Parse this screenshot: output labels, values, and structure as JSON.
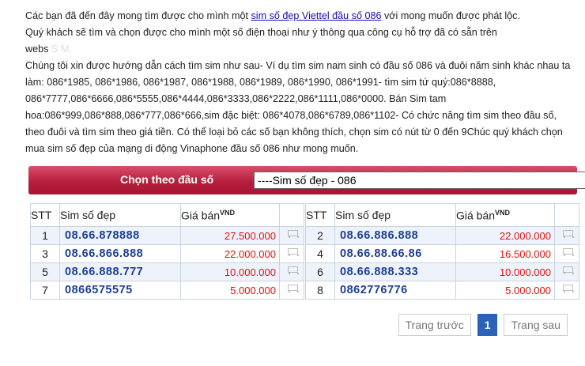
{
  "intro": {
    "line1_before": "Các bạn đã đến đây mong tìm được cho mình một ",
    "line1_link": "sim số đẹp Viettel đầu số 086",
    "line1_after": " với mong muốn được phát lộc.",
    "line2": "Quý khách sẽ tìm và chọn được cho mình một số điện thoại như ý thông qua công cụ hỗ trợ đã có sẵn trên",
    "line3": "webs",
    "line3_blur": "S                 ",
    "line3_end": "M.",
    "para2": " Chúng tôi xin được hướng dẫn cách tìm sim như sau- Ví dụ tìm sim nam sinh có đầu số 086 và đuôi năm sinh khác nhau ta làm: 086*1985, 086*1986, 086*1987, 086*1988, 086*1989, 086*1990, 086*1991- tìm sim tứ quý:086*8888, 086*7777,086*6666,086*5555,086*4444,086*3333,086*2222,086*1111,086*0000. Bán Sim tam hoa:086*999,086*888,086*777,086*666,sim đặc biệt: 086*4078,086*6789,086*1102- Có chức năng tìm sim theo đầu số, theo đuôi và tìm sim theo giá tiền. Có thể loại bỏ các số bạn không thích, chọn sim có nút từ 0 đến 9Chúc quý khách chọn mua sim số đẹp của mạng di động Vinaphone đầu số 086 như mong muốn."
  },
  "filter": {
    "label": "Chọn theo đầu số",
    "selected": "----Sim số đẹp - 086",
    "arrow": "▼"
  },
  "table_headers": {
    "stt": "STT",
    "number": "Sim số đẹp",
    "price": "Giá bán",
    "price_unit": "VND"
  },
  "left_rows": [
    {
      "stt": "1",
      "number": "08.66.878888",
      "price": "27.500.000"
    },
    {
      "stt": "3",
      "number": "08.66.866.888",
      "price": "22.000.000"
    },
    {
      "stt": "5",
      "number": "08.66.888.777",
      "price": "10.000.000"
    },
    {
      "stt": "7",
      "number": "0866575575",
      "price": "5.000.000"
    }
  ],
  "right_rows": [
    {
      "stt": "2",
      "number": "08.66.886.888",
      "price": "22.000.000"
    },
    {
      "stt": "4",
      "number": "08.66.88.66.86",
      "price": "16.500.000"
    },
    {
      "stt": "6",
      "number": "08.66.888.333",
      "price": "10.000.000"
    },
    {
      "stt": "8",
      "number": "0862776776",
      "price": "5.000.000"
    }
  ],
  "pager": {
    "prev": "Trang trước",
    "current": "1",
    "next": "Trang sau"
  }
}
